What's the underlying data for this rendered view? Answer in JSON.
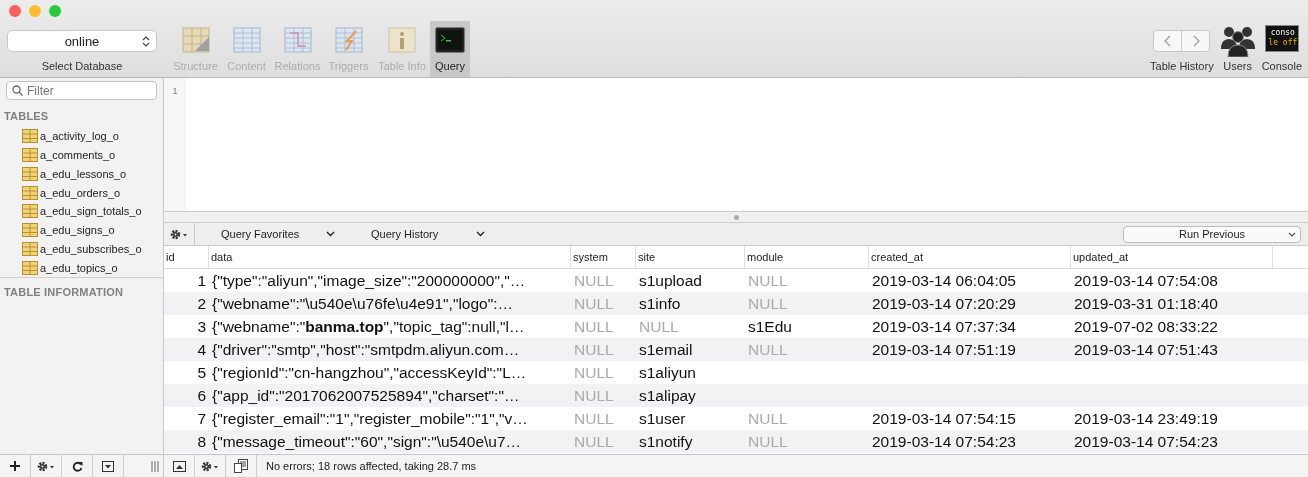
{
  "database_selector": {
    "value": "online",
    "label": "Select Database"
  },
  "toolbar": [
    {
      "label": "Structure",
      "kind": "structure",
      "selected": false
    },
    {
      "label": "Content",
      "kind": "content",
      "selected": false
    },
    {
      "label": "Relations",
      "kind": "relations",
      "selected": false
    },
    {
      "label": "Triggers",
      "kind": "triggers",
      "selected": false
    },
    {
      "label": "Table Info",
      "kind": "info",
      "selected": false
    },
    {
      "label": "Query",
      "kind": "query",
      "selected": true
    }
  ],
  "right_tools": {
    "history_label": "Table History",
    "users_label": "Users",
    "console_label": "Console",
    "console_icon_lines": [
      "conso",
      "le off"
    ]
  },
  "sidebar": {
    "filter_placeholder": "Filter",
    "tables_heading": "TABLES",
    "tables": [
      "a_activity_log_o",
      "a_comments_o",
      "a_edu_lessons_o",
      "a_edu_orders_o",
      "a_edu_sign_totals_o",
      "a_edu_signs_o",
      "a_edu_subscribes_o",
      "a_edu_topics_o"
    ],
    "info_heading": "TABLE INFORMATION"
  },
  "editor": {
    "line_numbers": [
      "1"
    ]
  },
  "query_bar": {
    "favorites": "Query Favorites",
    "history": "Query History",
    "run": "Run Previous"
  },
  "results": {
    "columns": [
      "id",
      "data",
      "system",
      "site",
      "module",
      "created_at",
      "updated_at"
    ],
    "rows": [
      {
        "cells": [
          {
            "text": "1",
            "is_null": false
          },
          {
            "text": "{\"type\":\"aliyun\",\"image_size\":\"200000000\",\"…",
            "is_null": false
          },
          {
            "text": "NULL",
            "is_null": true
          },
          {
            "text": "s1upload",
            "is_null": false
          },
          {
            "text": "NULL",
            "is_null": true
          },
          {
            "text": "2019-03-14 06:04:05",
            "is_null": false
          },
          {
            "text": "2019-03-14 07:54:08",
            "is_null": false
          }
        ]
      },
      {
        "cells": [
          {
            "text": "2",
            "is_null": false
          },
          {
            "text": "{\"webname\":\"\\u540e\\u76fe\\u4e91\",\"logo\":…",
            "is_null": false
          },
          {
            "text": "NULL",
            "is_null": true
          },
          {
            "text": "s1info",
            "is_null": false
          },
          {
            "text": "NULL",
            "is_null": true
          },
          {
            "text": "2019-03-14 07:20:29",
            "is_null": false
          },
          {
            "text": "2019-03-31 01:18:40",
            "is_null": false
          }
        ]
      },
      {
        "cells": [
          {
            "text": "3",
            "is_null": false
          },
          {
            "text": "{\"webname\":\"**banma.top**\",\"topic_tag\":null,\"l…",
            "is_null": false
          },
          {
            "text": "NULL",
            "is_null": true
          },
          {
            "text": "NULL",
            "is_null": true
          },
          {
            "text": "s1Edu",
            "is_null": false
          },
          {
            "text": "2019-03-14 07:37:34",
            "is_null": false
          },
          {
            "text": "2019-07-02 08:33:22",
            "is_null": false
          }
        ]
      },
      {
        "cells": [
          {
            "text": "4",
            "is_null": false
          },
          {
            "text": "{\"driver\":\"smtp\",\"host\":\"smtpdm.aliyun.com…",
            "is_null": false
          },
          {
            "text": "NULL",
            "is_null": true
          },
          {
            "text": "s1email",
            "is_null": false
          },
          {
            "text": "NULL",
            "is_null": true
          },
          {
            "text": "2019-03-14 07:51:19",
            "is_null": false
          },
          {
            "text": "2019-03-14 07:51:43",
            "is_null": false
          }
        ]
      },
      {
        "cells": [
          {
            "text": "5",
            "is_null": false
          },
          {
            "text": "{\"regionId\":\"cn-hangzhou\",\"accessKeyId\":\"L…",
            "is_null": false
          },
          {
            "text": "NULL",
            "is_null": true
          },
          {
            "text": "s1aliyun",
            "is_null": false
          }
        ]
      },
      {
        "cells": [
          {
            "text": "6",
            "is_null": false
          },
          {
            "text": "{\"app_id\":\"2017062007525894\",\"charset\":\"…",
            "is_null": false
          },
          {
            "text": "NULL",
            "is_null": true
          },
          {
            "text": "s1alipay",
            "is_null": false
          }
        ]
      },
      {
        "cells": [
          {
            "text": "7",
            "is_null": false
          },
          {
            "text": "{\"register_email\":\"1\",\"register_mobile\":\"1\",\"v…",
            "is_null": false
          },
          {
            "text": "NULL",
            "is_null": true
          },
          {
            "text": "s1user",
            "is_null": false
          },
          {
            "text": "NULL",
            "is_null": true
          },
          {
            "text": "2019-03-14 07:54:15",
            "is_null": false
          },
          {
            "text": "2019-03-14 23:49:19",
            "is_null": false
          }
        ]
      },
      {
        "cells": [
          {
            "text": "8",
            "is_null": false
          },
          {
            "text": "{\"message_timeout\":\"60\",\"sign\":\"\\u540e\\u7…",
            "is_null": false
          },
          {
            "text": "NULL",
            "is_null": true
          },
          {
            "text": "s1notify",
            "is_null": false
          },
          {
            "text": "NULL",
            "is_null": true
          },
          {
            "text": "2019-03-14 07:54:23",
            "is_null": false
          },
          {
            "text": "2019-03-14 07:54:23",
            "is_null": false
          }
        ]
      }
    ]
  },
  "status": "No errors; 18 rows affected, taking 28.7 ms"
}
